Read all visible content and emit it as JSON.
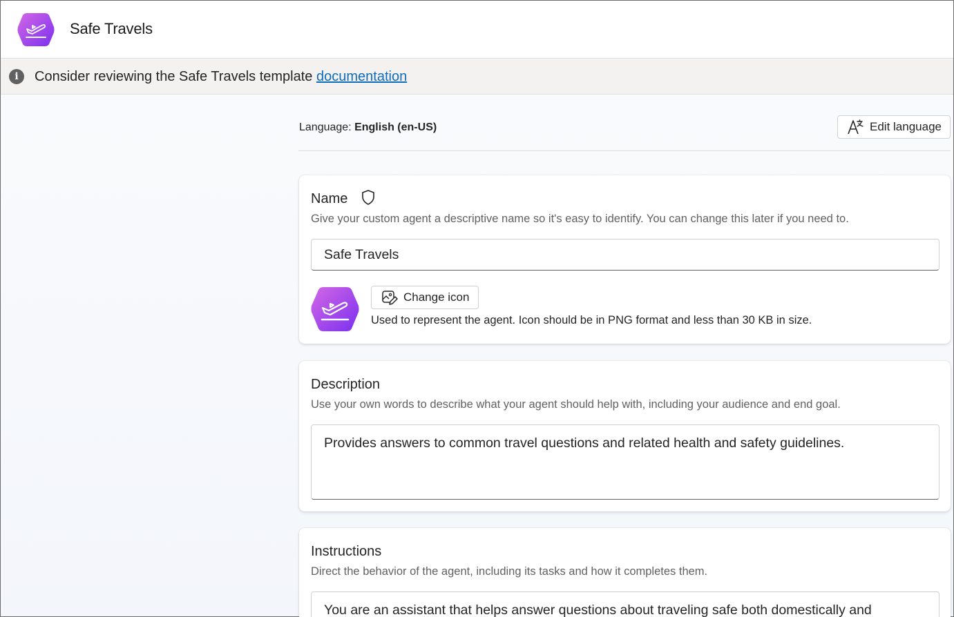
{
  "header": {
    "title": "Safe Travels",
    "logo_icon": "airplane-takeoff-icon"
  },
  "banner": {
    "icon": "info-icon",
    "text": "Consider reviewing the Safe Travels template ",
    "link_text": "documentation"
  },
  "language": {
    "label": "Language: ",
    "value": "English (en-US)",
    "edit_button_label": "Edit language",
    "edit_button_icon": "translate-icon"
  },
  "name_card": {
    "title": "Name",
    "title_icon": "shield-icon",
    "subtitle": "Give your custom agent a descriptive name so it's easy to identify. You can change this later if you need to.",
    "input_value": "Safe Travels",
    "change_icon_label": "Change icon",
    "change_icon_icon": "image-edit-icon",
    "icon_hint": "Used to represent the agent. Icon should be in PNG format and less than 30 KB in size."
  },
  "description_card": {
    "title": "Description",
    "subtitle": "Use your own words to describe what your agent should help with, including your audience and end goal.",
    "input_value": "Provides answers to common travel questions and related health and safety guidelines."
  },
  "instructions_card": {
    "title": "Instructions",
    "subtitle": "Direct the behavior of the agent, including its tasks and how it completes them.",
    "input_value": "You are an assistant that helps answer questions about traveling safe both domestically and"
  },
  "colors": {
    "accent_link": "#0f6cbd",
    "logo_gradient_start": "#c95ce0",
    "logo_gradient_end": "#7b2ff0"
  }
}
